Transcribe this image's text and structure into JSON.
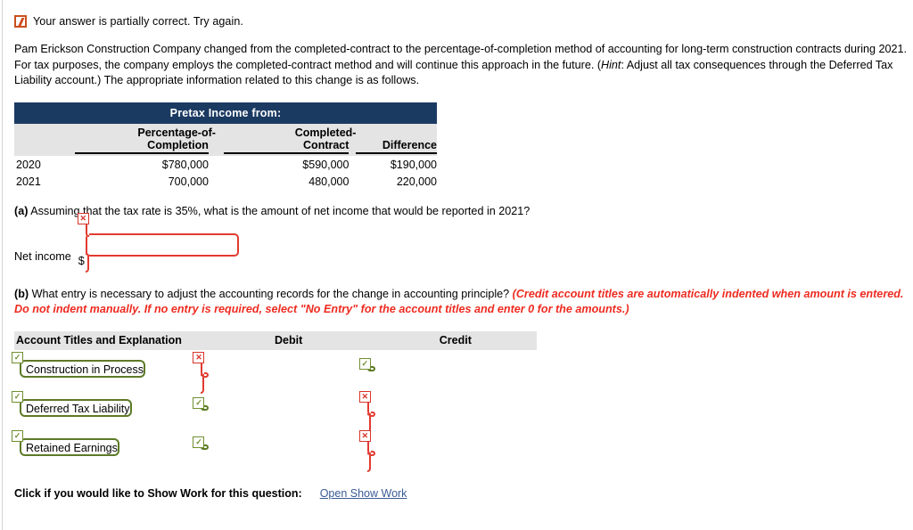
{
  "status": {
    "icon": "partial-credit-icon",
    "message": "Your answer is partially correct.  Try again."
  },
  "intro": {
    "part1": "Pam Erickson Construction Company changed from the completed-contract to the percentage-of-completion method of accounting for long-term construction contracts during 2021. For tax purposes, the company employs the completed-contract method and will continue this approach in the future. (",
    "hint_word": "Hint",
    "part2": ": Adjust all tax consequences through the Deferred Tax Liability account.) The appropriate information related to this change is as follows."
  },
  "pretax_table": {
    "band_title": "Pretax Income from:",
    "headers": {
      "year": "",
      "poc_line1": "Percentage-of-",
      "poc_line2": "Completion",
      "cc_line1": "Completed-",
      "cc_line2": "Contract",
      "difference": "Difference"
    },
    "rows": [
      {
        "year": "2020",
        "poc": "$780,000",
        "cc": "$590,000",
        "diff": "$190,000"
      },
      {
        "year": "2021",
        "poc": "700,000",
        "cc": "480,000",
        "diff": "220,000"
      }
    ]
  },
  "part_a": {
    "marker": "(a)",
    "question": " Assuming that the tax rate is 35%, what is the amount of net income that would be reported in 2021?",
    "net_income_label": "Net income",
    "dollar_sign": "$",
    "net_income_value": "",
    "net_income_state": "incorrect",
    "net_income_badge": "✕"
  },
  "part_b": {
    "marker": "(b)",
    "question": " What entry is necessary to adjust the accounting records for the change in accounting principle? ",
    "hint": "(Credit account titles are automatically indented when amount is entered. Do not indent manually. If no entry is required, select \"No Entry\" for the account titles and enter 0 for the amounts.)"
  },
  "journal": {
    "columns": {
      "account": "Account Titles and Explanation",
      "debit": "Debit",
      "credit": "Credit"
    },
    "rows": [
      {
        "account": {
          "value": "Construction in Process",
          "state": "correct",
          "badge": "✓"
        },
        "debit": {
          "value": "",
          "state": "incorrect",
          "badge": "✕"
        },
        "credit": {
          "value": "",
          "state": "correct",
          "badge": "✓"
        }
      },
      {
        "account": {
          "value": "Deferred Tax Liability",
          "state": "correct",
          "badge": "✓"
        },
        "debit": {
          "value": "",
          "state": "correct",
          "badge": "✓"
        },
        "credit": {
          "value": "",
          "state": "incorrect",
          "badge": "✕"
        }
      },
      {
        "account": {
          "value": "Retained Earnings",
          "state": "correct",
          "badge": "✓"
        },
        "debit": {
          "value": "",
          "state": "correct",
          "badge": "✓"
        },
        "credit": {
          "value": "",
          "state": "incorrect",
          "badge": "✕"
        }
      }
    ]
  },
  "show_work": {
    "label": "Click if you would like to Show Work for this question:",
    "link": "Open Show Work"
  },
  "colors": {
    "table_band": "#1b3a62",
    "header_gray": "#e4e4e4",
    "error_red": "#e23b30",
    "hint_red": "#ee2b20",
    "correct_green": "#5d7a26",
    "link_blue": "#3b5b94",
    "status_orange": "#c8501e"
  }
}
